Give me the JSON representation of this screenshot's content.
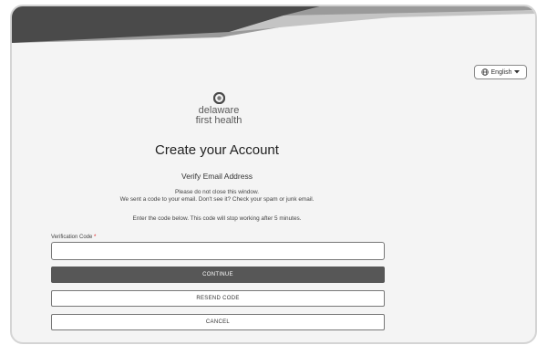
{
  "language": {
    "label": "English",
    "icon": "globe-icon",
    "caret": "chevron-down-icon"
  },
  "logo": {
    "line1": "delaware",
    "line2": "first health"
  },
  "page": {
    "title": "Create your Account",
    "subtitle": "Verify Email Address",
    "info_line1": "Please do not close this window.",
    "info_line2": "We sent a code to your email. Don't see it? Check your spam or junk email.",
    "info_line3": "Enter the code below. This code will stop working after 5 minutes."
  },
  "form": {
    "code_label": "Verification Code",
    "required_mark": "*",
    "code_value": "",
    "continue_label": "CONTINUE",
    "resend_label": "RESEND CODE",
    "cancel_label": "CANCEL"
  },
  "colors": {
    "banner_dark": "#4a4a4a",
    "primary_button": "#575757",
    "background": "#f4f4f4"
  }
}
